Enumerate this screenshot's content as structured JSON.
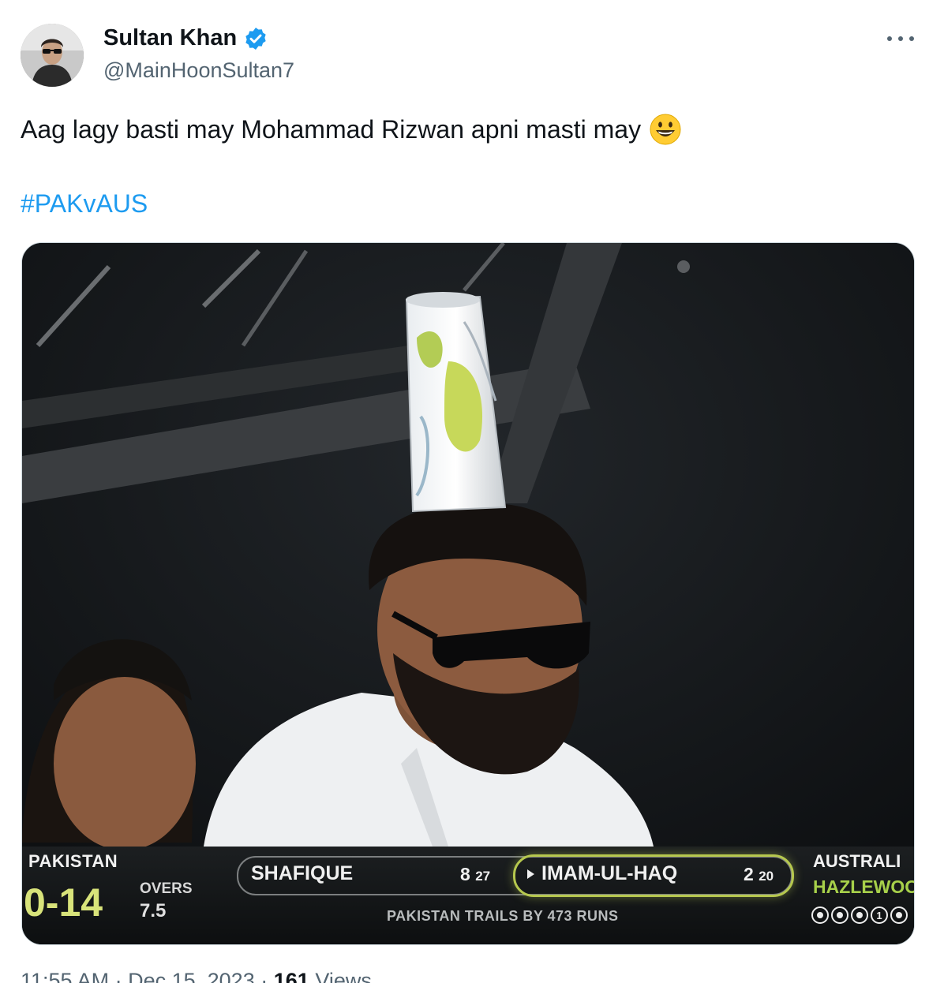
{
  "author": {
    "display_name": "Sultan Khan",
    "handle": "@MainHoonSultan7",
    "verified": true
  },
  "tweet": {
    "text": "Aag lagy basti may Mohammad Rizwan apni masti may",
    "emoji": "smiling-face-emoji",
    "hashtag": "#PAKvAUS"
  },
  "scoreboard": {
    "team_left": "PAKISTAN",
    "score_left": "0-14",
    "overs_label": "OVERS",
    "overs_value": "7.5",
    "batter1_name": "SHAFIQUE",
    "batter1_runs": "8",
    "batter1_balls": "27",
    "batter2_name": "IMAM-UL-HAQ",
    "batter2_runs": "2",
    "batter2_balls": "20",
    "trail_text": "PAKISTAN TRAILS BY 473 RUNS",
    "team_right": "AUSTRALI",
    "bowler": "HAZLEWOOD",
    "over_balls": [
      "dot",
      "dot",
      "dot",
      "1",
      "dot"
    ]
  },
  "meta": {
    "time": "11:55 AM",
    "date": "Dec 15, 2023",
    "views_count": "161",
    "views_label": "Views"
  },
  "colors": {
    "link": "#1d9bf0",
    "secondary_text": "#536471",
    "score_yellow": "#d8e37a",
    "bowler_green": "#a7d04a"
  }
}
